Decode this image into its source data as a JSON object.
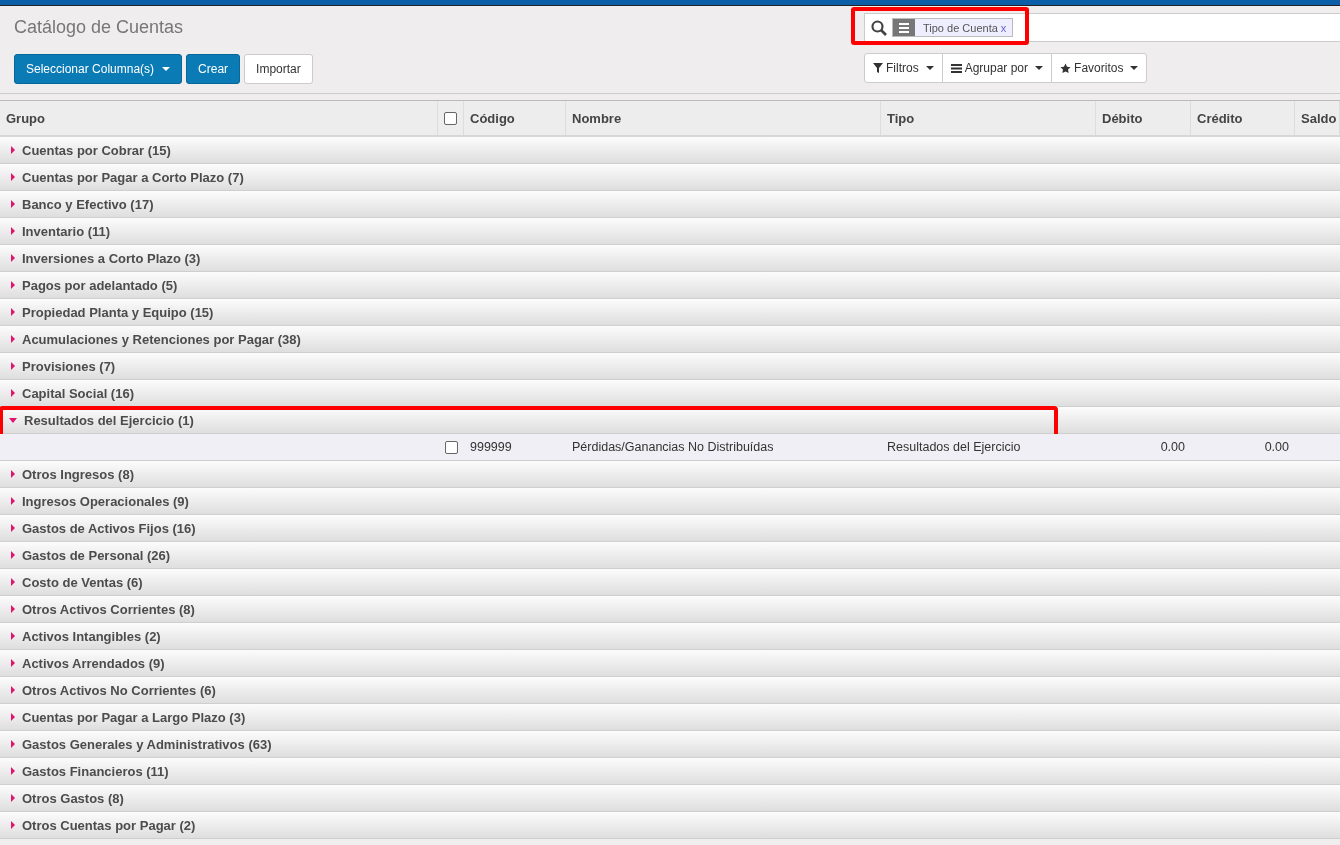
{
  "title": "Catálogo de Cuentas",
  "buttons": [
    {
      "label": "Seleccionar Columna(s)",
      "kind": "dropdown"
    },
    {
      "label": "Crear",
      "kind": "primary"
    },
    {
      "label": "Importar",
      "kind": "default"
    }
  ],
  "search": {
    "facet": "Tipo de Cuenta",
    "remove": "x"
  },
  "search_options": [
    {
      "label": "Filtros",
      "kind": "filter"
    },
    {
      "label": "Agrupar por",
      "kind": "group"
    },
    {
      "label": "Favoritos",
      "kind": "star"
    }
  ],
  "table": {
    "columns": [
      "Grupo",
      "Código",
      "Nombre",
      "Tipo",
      "Débito",
      "Crédito",
      "Saldo"
    ],
    "select_all": {
      "checked": false
    },
    "groups": [
      {
        "label": "Cuentas por Cobrar (15)",
        "expanded": false
      },
      {
        "label": "Cuentas por Pagar a Corto Plazo (7)",
        "expanded": false
      },
      {
        "label": "Banco y Efectivo (17)",
        "expanded": false
      },
      {
        "label": "Inventario (11)",
        "expanded": false
      },
      {
        "label": "Inversiones a Corto Plazo (3)",
        "expanded": false
      },
      {
        "label": "Pagos por adelantado (5)",
        "expanded": false
      },
      {
        "label": "Propiedad Planta y Equipo (15)",
        "expanded": false
      },
      {
        "label": "Acumulaciones y Retenciones por Pagar (38)",
        "expanded": false
      },
      {
        "label": "Provisiones (7)",
        "expanded": false
      },
      {
        "label": "Capital Social (16)",
        "expanded": false
      },
      {
        "label": "Resultados del Ejercicio (1)",
        "expanded": true,
        "highlighted": true,
        "rows": [
          {
            "checked": false,
            "code": "999999",
            "name": "Pérdidas/Ganancias No Distribuídas",
            "type": "Resultados del Ejercicio",
            "debit": "0.00",
            "credit": "0.00"
          }
        ]
      },
      {
        "label": "Otros Ingresos (8)",
        "expanded": false
      },
      {
        "label": "Ingresos Operacionales (9)",
        "expanded": false
      },
      {
        "label": "Gastos de Activos Fijos (16)",
        "expanded": false
      },
      {
        "label": "Gastos de Personal (26)",
        "expanded": false
      },
      {
        "label": "Costo de Ventas (6)",
        "expanded": false
      },
      {
        "label": "Otros Activos Corrientes (8)",
        "expanded": false
      },
      {
        "label": "Activos Intangibles (2)",
        "expanded": false
      },
      {
        "label": "Activos Arrendados (9)",
        "expanded": false
      },
      {
        "label": "Otros Activos No Corrientes (6)",
        "expanded": false
      },
      {
        "label": "Cuentas por Pagar a Largo Plazo (3)",
        "expanded": false
      },
      {
        "label": "Gastos Generales y Administrativos (63)",
        "expanded": false
      },
      {
        "label": "Gastos Financieros (11)",
        "expanded": false
      },
      {
        "label": "Otros Gastos (8)",
        "expanded": false
      },
      {
        "label": "Otros Cuentas por Pagar (2)",
        "expanded": false
      }
    ]
  }
}
